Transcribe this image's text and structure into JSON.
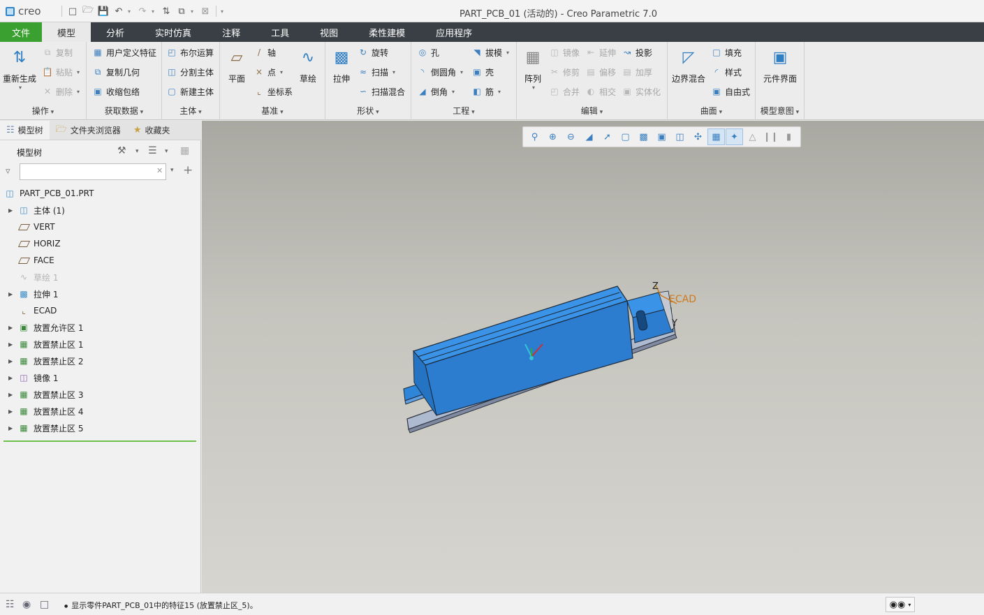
{
  "app": {
    "logo": "creo",
    "window_title": "PART_PCB_01 (活动的) - Creo Parametric 7.0"
  },
  "tabs": [
    "文件",
    "模型",
    "分析",
    "实时仿真",
    "注释",
    "工具",
    "视图",
    "柔性建模",
    "应用程序"
  ],
  "ribbon": {
    "operations": {
      "label": "操作",
      "regen": "重新生成",
      "copy": "复制",
      "paste": "粘贴",
      "delete": "删除"
    },
    "get_data": {
      "label": "获取数据",
      "udf": "用户定义特征",
      "copy_geom": "复制几何",
      "shrinkwrap": "收缩包络"
    },
    "body": {
      "label": "主体",
      "boolean": "布尔运算",
      "split": "分割主体",
      "new": "新建主体"
    },
    "datum": {
      "label": "基准",
      "plane": "平面",
      "axis": "轴",
      "point": "点",
      "csys": "坐标系",
      "sketch": "草绘"
    },
    "shapes": {
      "label": "形状",
      "extrude": "拉伸",
      "revolve": "旋转",
      "sweep": "扫描",
      "swept_blend": "扫描混合"
    },
    "engineering": {
      "label": "工程",
      "hole": "孔",
      "round": "倒圆角",
      "chamfer": "倒角",
      "draft": "拔模",
      "shell": "壳",
      "rib": "筋"
    },
    "editing": {
      "label": "编辑",
      "pattern": "阵列",
      "mirror": "镜像",
      "trim": "修剪",
      "merge": "合并",
      "extend": "延伸",
      "offset": "偏移",
      "intersect": "相交",
      "project": "投影",
      "thicken": "加厚",
      "solidify": "实体化"
    },
    "surfaces": {
      "label": "曲面",
      "boundary_blend": "边界混合",
      "fill": "填充",
      "style": "样式",
      "freestyle": "自由式"
    },
    "model_intent": {
      "label": "模型意图",
      "component_interface": "元件界面"
    }
  },
  "panel": {
    "tabs": [
      "模型树",
      "文件夹浏览器",
      "收藏夹"
    ],
    "tree_label": "模型树",
    "filter_placeholder": ""
  },
  "tree": [
    {
      "label": "PART_PCB_01.PRT",
      "icon": "part-icon",
      "expandable": false,
      "root": true
    },
    {
      "label": "主体 (1)",
      "icon": "body-icon",
      "expandable": true
    },
    {
      "label": "VERT",
      "icon": "datum-plane-icon",
      "expandable": false
    },
    {
      "label": "HORIZ",
      "icon": "datum-plane-icon",
      "expandable": false
    },
    {
      "label": "FACE",
      "icon": "datum-plane-icon",
      "expandable": false
    },
    {
      "label": "草绘 1",
      "icon": "sketch-icon",
      "expandable": false,
      "dim": true
    },
    {
      "label": "拉伸 1",
      "icon": "extrude-icon",
      "expandable": true
    },
    {
      "label": "ECAD",
      "icon": "csys-icon",
      "expandable": false
    },
    {
      "label": "放置允许区 1",
      "icon": "keep-in-icon",
      "expandable": true
    },
    {
      "label": "放置禁止区 1",
      "icon": "keep-out-icon",
      "expandable": true
    },
    {
      "label": "放置禁止区 2",
      "icon": "keep-out-icon",
      "expandable": true
    },
    {
      "label": "镜像 1",
      "icon": "mirror-icon",
      "expandable": true
    },
    {
      "label": "放置禁止区 3",
      "icon": "keep-out-icon",
      "expandable": true
    },
    {
      "label": "放置禁止区 4",
      "icon": "keep-out-icon",
      "expandable": true
    },
    {
      "label": "放置禁止区 5",
      "icon": "keep-out-icon",
      "expandable": true
    }
  ],
  "viewport": {
    "csys_labels": {
      "z": "Z",
      "y": "Y",
      "name": "ECAD"
    },
    "model_color": "#2f86d8",
    "background_top": "#a9a8a1",
    "background_bottom": "#d6d5cf"
  },
  "status": {
    "message": "显示零件PART_PCB_01中的特征15 (放置禁止区_5)。"
  },
  "colors": {
    "file_tab": "#3aa030",
    "tab_bar": "#3a3f45",
    "accent": "#2f7fc4"
  }
}
